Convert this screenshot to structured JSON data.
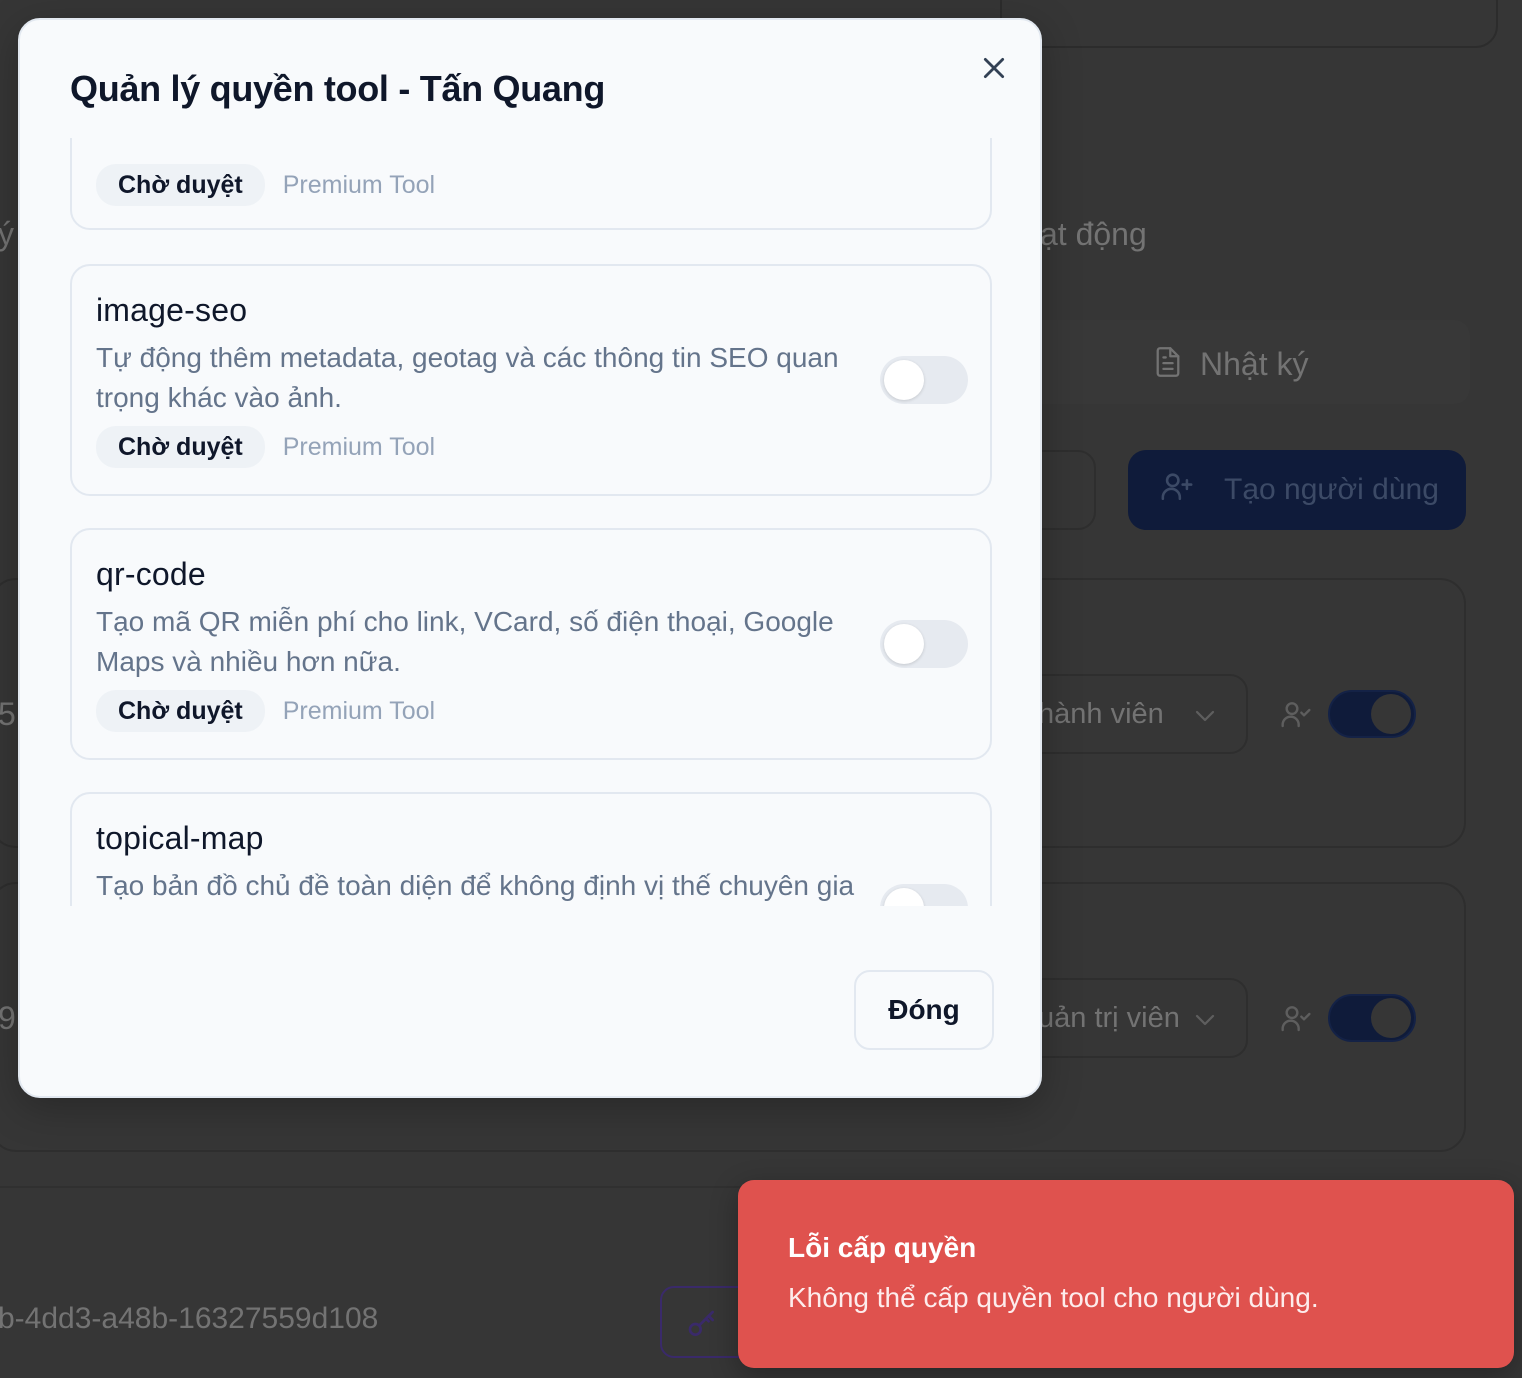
{
  "background": {
    "partial_texts": {
      "activity_tab_fragment": "ạt động",
      "log_tab": "Nhật ký",
      "create_user_button": "Tạo người dùng",
      "member_select": "hành viên",
      "admin_select": "uản trị viên",
      "user_id_fragment": "b-4dd3-a48b-16327559d108",
      "left_fragment_1": "ý",
      "left_fragment_2": "5",
      "left_fragment_3": "9"
    }
  },
  "modal": {
    "title": "Quản lý quyền tool - Tấn Quang",
    "tools": [
      {
        "name": "",
        "description": "",
        "status": "Chờ duyệt",
        "type": "Premium Tool",
        "enabled": false
      },
      {
        "name": "image-seo",
        "description": "Tự động thêm metadata, geotag và các thông tin SEO quan trọng khác vào ảnh.",
        "status": "Chờ duyệt",
        "type": "Premium Tool",
        "enabled": false
      },
      {
        "name": "qr-code",
        "description": "Tạo mã QR miễn phí cho link, VCard, số điện thoại, Google Maps và nhiều hơn nữa.",
        "status": "Chờ duyệt",
        "type": "Premium Tool",
        "enabled": false
      },
      {
        "name": "topical-map",
        "description": "Tạo bản đồ chủ đề toàn diện để không định vị thế chuyên gia (Topical Authority)",
        "status": "",
        "type": "",
        "enabled": false
      }
    ],
    "close_button": "Đóng"
  },
  "toast": {
    "title": "Lỗi cấp quyền",
    "description": "Không thể cấp quyền tool cho người dùng.",
    "color": "#df524e"
  },
  "icons": {
    "close": "close-icon",
    "log": "file-text-icon",
    "create_user": "user-plus-icon",
    "user_check": "user-check-icon",
    "chevron": "chevron-down-icon",
    "key": "key-icon"
  }
}
